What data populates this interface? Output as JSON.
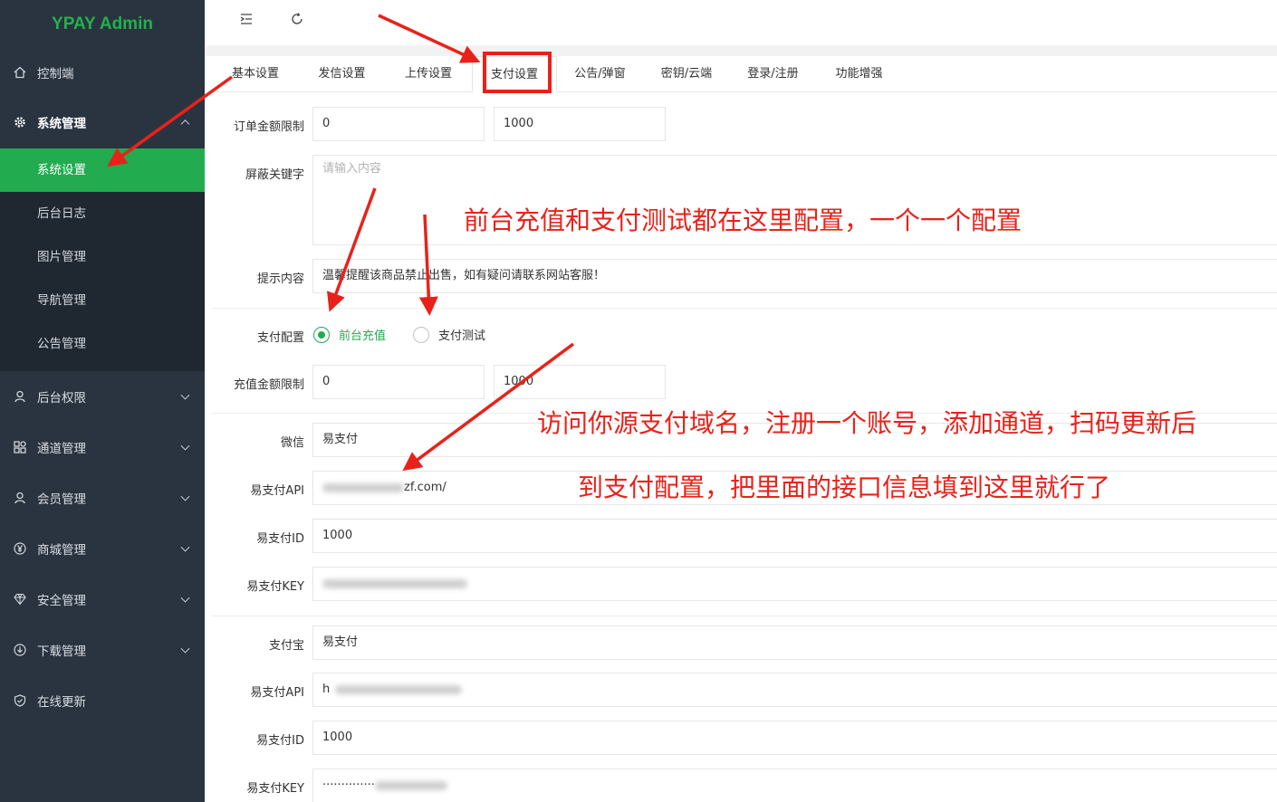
{
  "brand": "YPAY Admin",
  "sidebar": {
    "items": [
      {
        "label": "控制端",
        "icon": "home-icon"
      },
      {
        "label": "系统管理",
        "icon": "gear-icon"
      },
      {
        "label": "后台权限",
        "icon": "user-icon"
      },
      {
        "label": "通道管理",
        "icon": "grid-icon"
      },
      {
        "label": "会员管理",
        "icon": "user-icon"
      },
      {
        "label": "商城管理",
        "icon": "yen-icon"
      },
      {
        "label": "安全管理",
        "icon": "diamond-icon"
      },
      {
        "label": "下载管理",
        "icon": "download-icon"
      },
      {
        "label": "在线更新",
        "icon": "shield-icon"
      }
    ],
    "sub_items": [
      "系统设置",
      "后台日志",
      "图片管理",
      "导航管理",
      "公告管理"
    ]
  },
  "tabs": [
    "基本设置",
    "发信设置",
    "上传设置",
    "支付设置",
    "公告/弹窗",
    "密钥/云端",
    "登录/注册",
    "功能增强"
  ],
  "form": {
    "order_limit_label": "订单金额限制",
    "order_min": "0",
    "order_max": "1000",
    "keywords_label": "屏蔽关键字",
    "keywords_placeholder": "请输入内容",
    "tip_label": "提示内容",
    "tip_value": "温馨提醒该商品禁止出售，如有疑问请联系网站客服！",
    "pay_config_label": "支付配置",
    "radio_front": "前台充值",
    "radio_test": "支付测试",
    "recharge_limit_label": "充值金额限制",
    "recharge_min": "0",
    "recharge_max": "1000",
    "wechat_label": "微信",
    "wechat_value": "易支付",
    "api_label": "易支付API",
    "wechat_api_value": "zf.com/",
    "id_label": "易支付ID",
    "wechat_id_value": "1000",
    "key_label": "易支付KEY",
    "alipay_label": "支付宝",
    "alipay_value": "易支付",
    "alipay_api_value": "h",
    "alipay_id_value": "1000",
    "alipay_key_value": "··············"
  },
  "annotations": {
    "note1": "前台充值和支付测试都在这里配置，一个一个配置",
    "note2": "访问你源支付域名，注册一个账号，添加通道，扫码更新后",
    "note3": "到支付配置，把里面的接口信息填到这里就行了"
  },
  "colors": {
    "sidebar": "#2a3440",
    "brand": "#22b14c",
    "accent": "#22ab4f",
    "annotation": "#e8221a"
  }
}
